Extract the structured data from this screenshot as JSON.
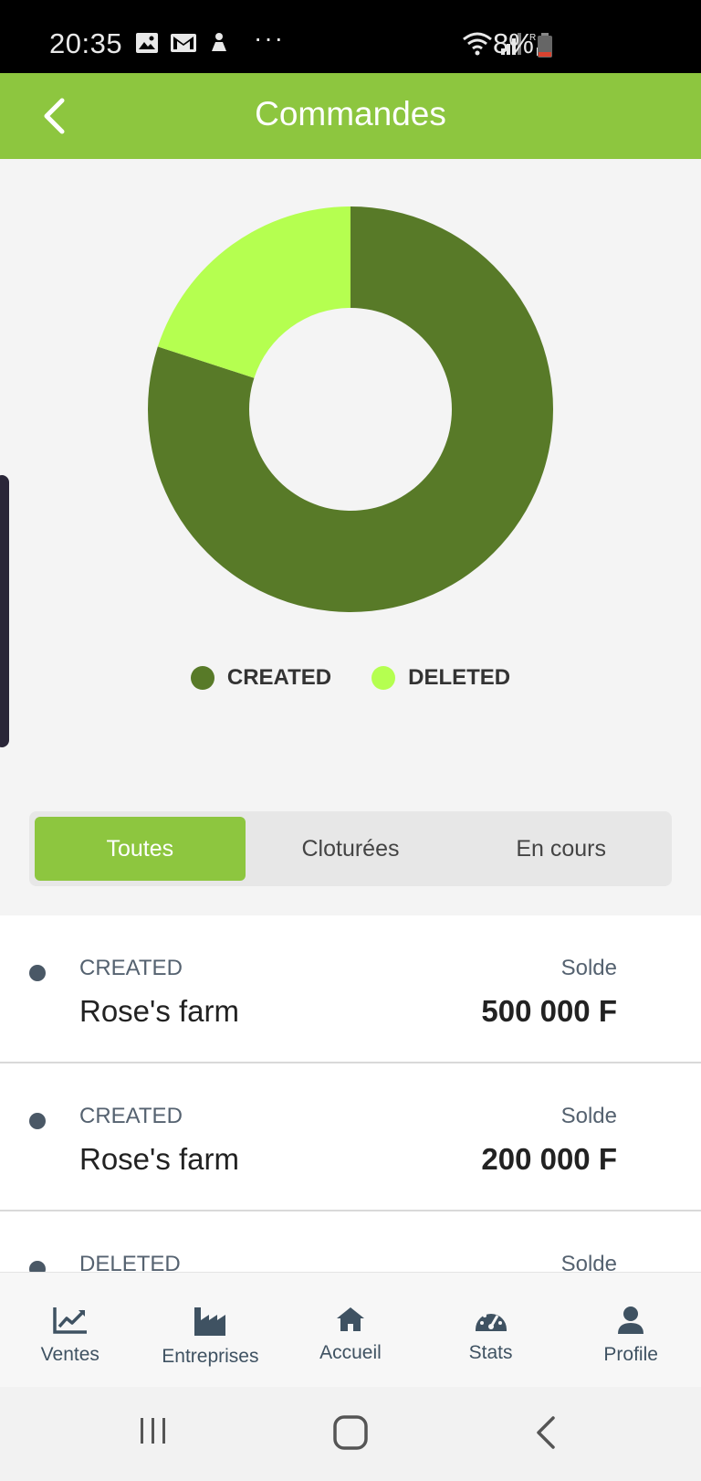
{
  "status_bar": {
    "time": "20:35",
    "battery": "8%",
    "icons": [
      "image-icon",
      "gmail-icon",
      "notification-icon",
      "more-dots",
      "wifi-icon",
      "signal-icon",
      "roaming-signal-icon",
      "battery-low-icon"
    ],
    "dots": "···"
  },
  "header": {
    "title": "Commandes",
    "back_icon": "chevron-left-icon",
    "color": "#8dc63f"
  },
  "chart_data": {
    "type": "pie",
    "style": "donut",
    "categories": [
      "CREATED",
      "DELETED"
    ],
    "values": [
      4,
      1
    ],
    "colors": [
      "#587a28",
      "#b5ff50"
    ],
    "legend_position": "bottom-center"
  },
  "filters": {
    "tabs": [
      {
        "label": "Toutes",
        "active": true
      },
      {
        "label": "Cloturées",
        "active": false
      },
      {
        "label": "En cours",
        "active": false
      }
    ]
  },
  "orders": [
    {
      "status": "CREATED",
      "name": "Rose's farm",
      "solde_label": "Solde",
      "amount": "500 000 F"
    },
    {
      "status": "CREATED",
      "name": "Rose's farm",
      "solde_label": "Solde",
      "amount": "200 000 F"
    },
    {
      "status": "DELETED",
      "name": "",
      "solde_label": "Solde",
      "amount": ""
    }
  ],
  "bottom_nav": [
    {
      "label": "Ventes",
      "icon": "chart-line-icon"
    },
    {
      "label": "Entreprises",
      "icon": "factory-icon"
    },
    {
      "label": "Accueil",
      "icon": "home-icon"
    },
    {
      "label": "Stats",
      "icon": "gauge-icon"
    },
    {
      "label": "Profile",
      "icon": "user-icon"
    }
  ],
  "system_nav": [
    "recent-apps-icon",
    "home-button-icon",
    "back-icon"
  ]
}
